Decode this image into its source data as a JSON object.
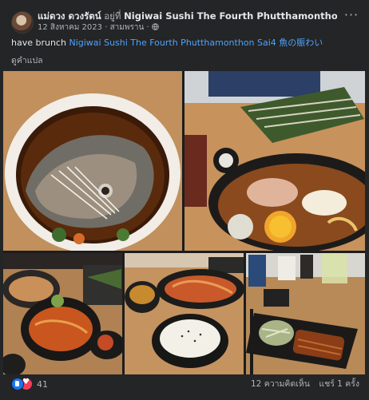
{
  "post": {
    "author": "แม่ดวง ดวงรัตน์",
    "at_text": "อยู่ที่",
    "place": "Nigiwai Sushi The Fourth Phutthamonthon Sai4 魚の賑わい",
    "date": "12 สิงหาคม 2023",
    "location_text": "สามพราน",
    "privacy_icon": "globe-icon",
    "more_label": "···"
  },
  "caption": {
    "text": "have brunch",
    "link": "Nigiwai Sushi The Fourth Phutthamonthon Sai4 魚の賑わい"
  },
  "translate_label": "ดูคำแปล",
  "photos": [
    {
      "name": "photo-salmon-head-stew",
      "icon": "photo"
    },
    {
      "name": "photo-hotpot-egg",
      "icon": "photo"
    },
    {
      "name": "photo-set-meal",
      "icon": "photo"
    },
    {
      "name": "photo-rice-bowl",
      "icon": "photo"
    },
    {
      "name": "photo-grilled-eel",
      "icon": "photo"
    }
  ],
  "reactions": {
    "count": "41",
    "types": [
      "like-icon",
      "love-icon"
    ],
    "colors": {
      "like": "#1877f2",
      "love": "#f33e58"
    }
  },
  "stats": {
    "comments": "12 ความคิดเห็น",
    "shares": "แชร์ 1 ครั้ง"
  },
  "colors": {
    "background": "#242526",
    "text": "#e4e6eb",
    "secondary": "#b0b3b8",
    "link": "#4ea2ff"
  }
}
